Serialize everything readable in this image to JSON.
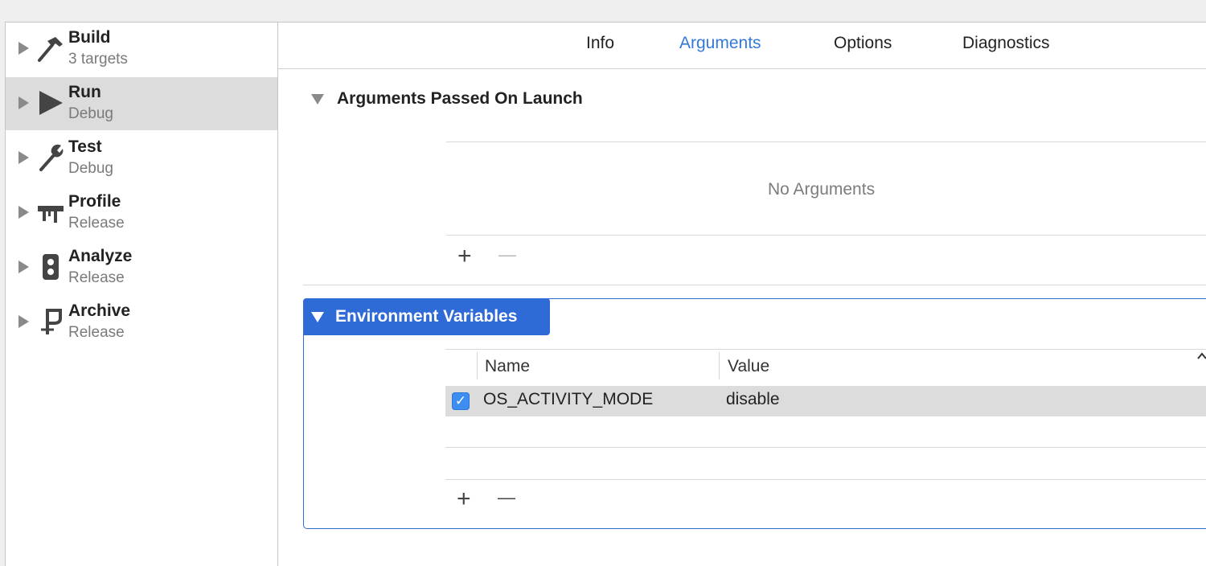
{
  "sidebar": {
    "items": [
      {
        "name": "Build",
        "subtitle": "3 targets",
        "icon": "hammer-icon",
        "selected": false
      },
      {
        "name": "Run",
        "subtitle": "Debug",
        "icon": "play-icon",
        "selected": true
      },
      {
        "name": "Test",
        "subtitle": "Debug",
        "icon": "wrench-icon",
        "selected": false
      },
      {
        "name": "Profile",
        "subtitle": "Release",
        "icon": "profile-gauge-icon",
        "selected": false
      },
      {
        "name": "Analyze",
        "subtitle": "Release",
        "icon": "analyze-icon",
        "selected": false
      },
      {
        "name": "Archive",
        "subtitle": "Release",
        "icon": "archive-icon",
        "selected": false
      }
    ]
  },
  "tabs": [
    {
      "label": "Info",
      "active": false
    },
    {
      "label": "Arguments",
      "active": true
    },
    {
      "label": "Options",
      "active": false
    },
    {
      "label": "Diagnostics",
      "active": false
    }
  ],
  "arguments": {
    "title": "Arguments Passed On Launch",
    "empty_text": "No Arguments",
    "add_label": "+",
    "remove_label": "—"
  },
  "environment": {
    "title": "Environment Variables",
    "columns": {
      "name": "Name",
      "value": "Value"
    },
    "rows": [
      {
        "enabled": true,
        "name": "OS_ACTIVITY_MODE",
        "value": "disable"
      }
    ],
    "add_label": "+",
    "remove_label": "—"
  },
  "colors": {
    "accent": "#2f6bd6",
    "active_tab": "#3478d8",
    "selection": "#dcdcdc"
  }
}
